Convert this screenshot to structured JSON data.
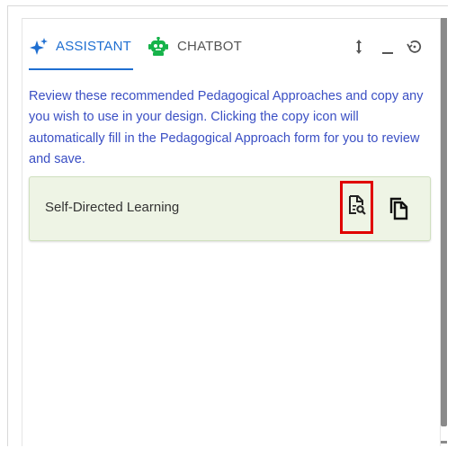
{
  "tabs": [
    {
      "label": "ASSISTANT",
      "icon": "sparkle-icon",
      "active": true
    },
    {
      "label": "CHATBOT",
      "icon": "robot-icon",
      "active": false
    }
  ],
  "header_actions": [
    "resize-vertical-icon",
    "minimize-icon",
    "history-icon"
  ],
  "instructions": "Review these recommended Pedagogical Approaches and copy any you wish to use in your design. Clicking the copy icon will automatically fill in the Pedagogical Approach form for you to review and save.",
  "recommendations": [
    {
      "title": "Self-Directed Learning",
      "actions": [
        "document-search-icon",
        "copy-icon"
      ]
    }
  ],
  "colors": {
    "accent": "#1f6fd1",
    "instruction_text": "#3a4fc4",
    "robot_green": "#16b34a",
    "card_background": "#eef4e5",
    "highlight_box": "#e00000"
  }
}
